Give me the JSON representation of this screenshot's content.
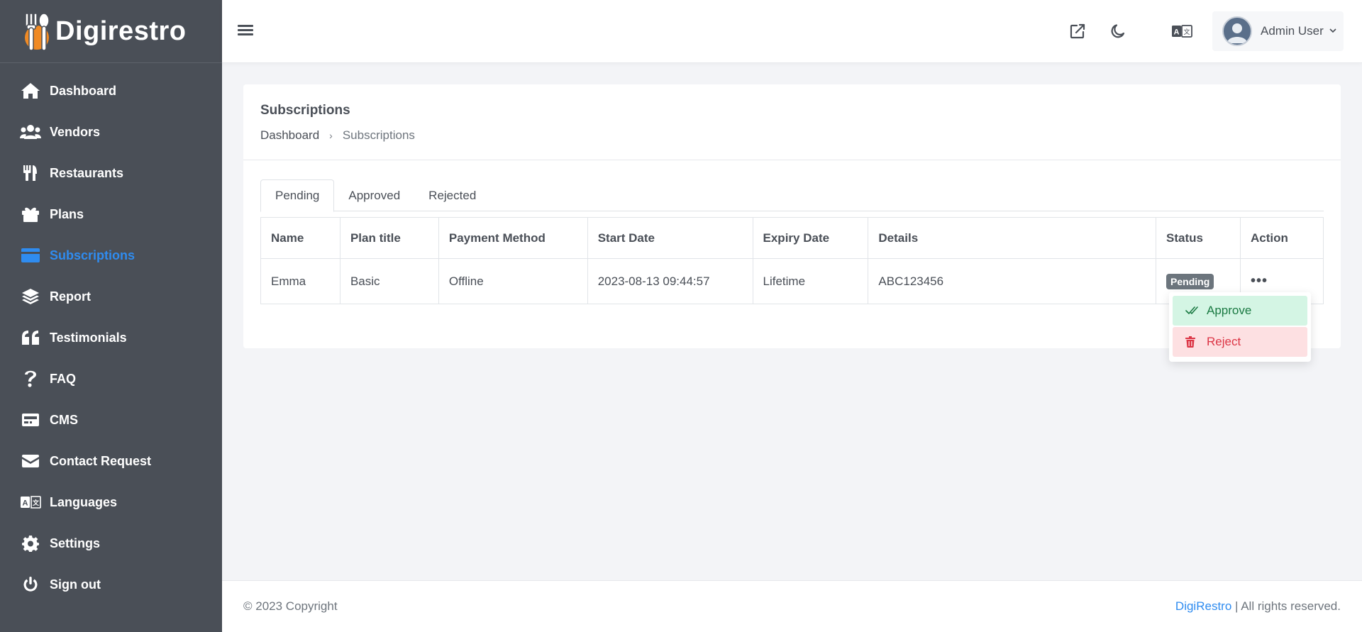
{
  "brand": {
    "name": "Digirestro",
    "logo_icon": "fork-spoon-logo",
    "accent": "#f08a24"
  },
  "sidebar": {
    "items": [
      {
        "label": "Dashboard",
        "icon": "home-icon"
      },
      {
        "label": "Vendors",
        "icon": "users-icon"
      },
      {
        "label": "Restaurants",
        "icon": "utensils-icon"
      },
      {
        "label": "Plans",
        "icon": "gift-icon"
      },
      {
        "label": "Subscriptions",
        "icon": "credit-card-icon",
        "active": true
      },
      {
        "label": "Report",
        "icon": "layers-icon"
      },
      {
        "label": "Testimonials",
        "icon": "quote-icon"
      },
      {
        "label": "FAQ",
        "icon": "question-icon"
      },
      {
        "label": "CMS",
        "icon": "cms-icon"
      },
      {
        "label": "Contact Request",
        "icon": "envelope-icon"
      },
      {
        "label": "Languages",
        "icon": "translate-icon"
      },
      {
        "label": "Settings",
        "icon": "gear-icon"
      },
      {
        "label": "Sign out",
        "icon": "power-icon"
      }
    ],
    "active_color": "#2f8cf0"
  },
  "header": {
    "user_name": "Admin User",
    "icons": [
      "external-link-icon",
      "moon-icon",
      "translate-icon"
    ]
  },
  "page": {
    "title": "Subscriptions",
    "breadcrumb": {
      "home": "Dashboard",
      "separator": "›",
      "current": "Subscriptions"
    }
  },
  "tabs": [
    {
      "label": "Pending",
      "active": true
    },
    {
      "label": "Approved"
    },
    {
      "label": "Rejected"
    }
  ],
  "table": {
    "columns": [
      "Name",
      "Plan title",
      "Payment Method",
      "Start Date",
      "Expiry Date",
      "Details",
      "Status",
      "Action"
    ],
    "rows": [
      {
        "name": "Emma",
        "plan": "Basic",
        "payment": "Offline",
        "start": "2023-08-13 09:44:57",
        "expiry": "Lifetime",
        "details": "ABC123456",
        "status": "Pending",
        "action": "•••"
      }
    ]
  },
  "dropdown": {
    "approve": "Approve",
    "reject": "Reject"
  },
  "footer": {
    "copyright": "© 2023 Copyright",
    "brand": "DigiRestro",
    "rights": "| All rights reserved."
  }
}
